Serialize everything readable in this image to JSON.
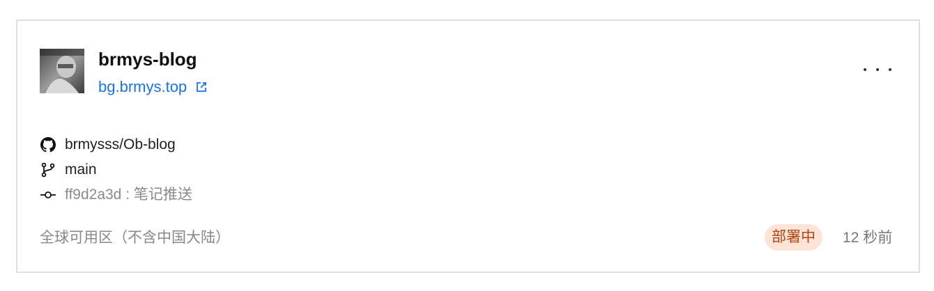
{
  "project": {
    "name": "brmys-blog",
    "domain": "bg.brmys.top"
  },
  "repo": {
    "icon": "github-icon",
    "name": "brmysss/Ob-blog"
  },
  "branch": {
    "icon": "branch-icon",
    "name": "main"
  },
  "commit": {
    "icon": "commit-icon",
    "hash": "ff9d2a3d",
    "separator": " : ",
    "message": "笔记推送"
  },
  "region": "全球可用区（不含中国大陆）",
  "status": {
    "label": "部署中",
    "bg_color": "#fde4d6",
    "text_color": "#b24410"
  },
  "time_ago": "12 秒前",
  "colors": {
    "link": "#1a73e8",
    "border": "#dcdfe4"
  }
}
